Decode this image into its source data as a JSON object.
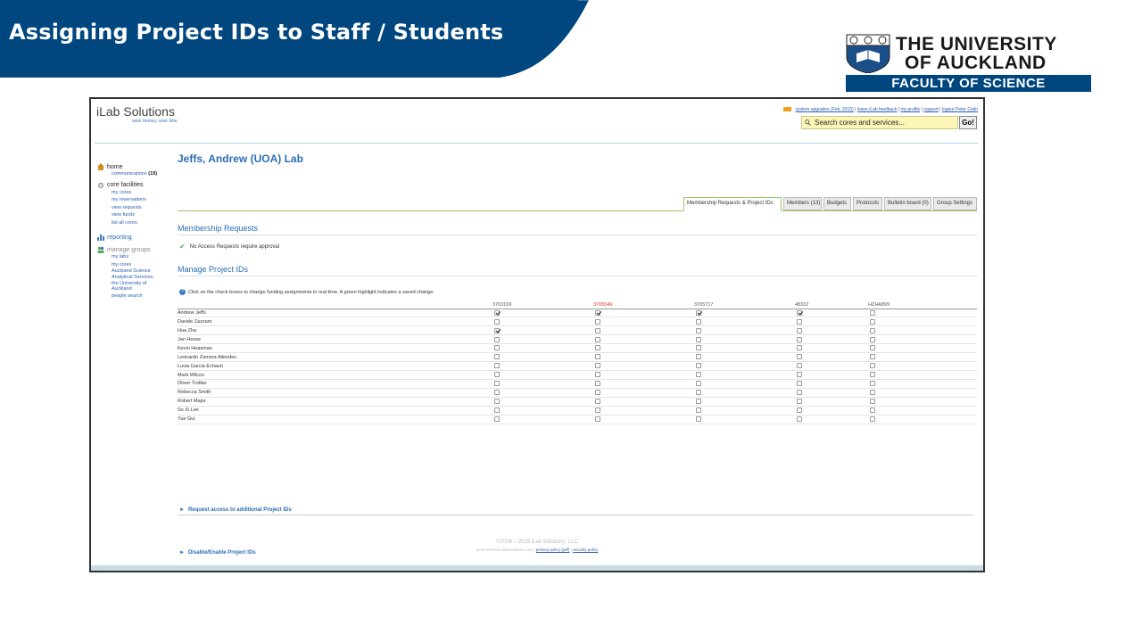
{
  "slide": {
    "title": "Assigning Project IDs to Staff / Students",
    "logo": {
      "line1": "THE UNIVERSITY",
      "line2": "OF AUCKLAND",
      "faculty": "FACULTY OF SCIENCE"
    }
  },
  "colors": {
    "banner": "#00467f",
    "link": "#2c6db5",
    "tab_border": "#9cc56c",
    "red_project": "#d83030"
  },
  "ilab": {
    "logo": "iLab Solutions",
    "tagline": "save money, save time",
    "top_links": [
      "system upgrades (Feb, 2015)",
      "leave iLab feedback",
      "my profile",
      "support",
      "logout Peter Cetin"
    ],
    "search_placeholder": "Search cores and services...",
    "go_label": "Go!"
  },
  "sidebar": {
    "home": "home",
    "communications": "communications",
    "communications_count": "(19)",
    "core_facilities": "core facilities",
    "core_items": [
      "my cores",
      "my reservations",
      "view requests",
      "view funds",
      "list all cores"
    ],
    "reporting": "reporting",
    "manage_groups": "manage groups",
    "group_items": [
      "my labs",
      "my cores",
      "Auckland Science",
      "Analytical Services,",
      "the University of",
      "Auckland",
      "people search"
    ]
  },
  "main": {
    "lab_title": "Jeffs, Andrew (UOA) Lab",
    "tabs": [
      "Membership Requests & Project IDs",
      "Members (13)",
      "Budgets",
      "Protocols",
      "Bulletin board (0)",
      "Group Settings"
    ],
    "membership_heading": "Membership Requests",
    "membership_note": "No Access Requests require approval",
    "manage_heading": "Manage Project IDs",
    "manage_note": "Click on the check boxes to change funding assignments in real time. A green highlight indicates a saved change.",
    "project_ids": [
      "3703199",
      "3705549",
      "3705717",
      "48332",
      "HZHA899"
    ],
    "members": [
      {
        "name": "Andrew Jeffs",
        "checks": [
          true,
          true,
          true,
          true,
          false
        ]
      },
      {
        "name": "Davide Zazzaro",
        "checks": [
          false,
          false,
          false,
          false,
          false
        ]
      },
      {
        "name": "Hua Zha",
        "checks": [
          true,
          false,
          false,
          false,
          false
        ]
      },
      {
        "name": "Jan Hesse",
        "checks": [
          false,
          false,
          false,
          false,
          false
        ]
      },
      {
        "name": "Kevin Heasman",
        "checks": [
          false,
          false,
          false,
          false,
          false
        ]
      },
      {
        "name": "Leonardo Zamora Allendes",
        "checks": [
          false,
          false,
          false,
          false,
          false
        ]
      },
      {
        "name": "Luvia Garcia Echauri",
        "checks": [
          false,
          false,
          false,
          false,
          false
        ]
      },
      {
        "name": "Mark Wilcox",
        "checks": [
          false,
          false,
          false,
          false,
          false
        ]
      },
      {
        "name": "Oliver Trottier",
        "checks": [
          false,
          false,
          false,
          false,
          false
        ]
      },
      {
        "name": "Rebecca Smith",
        "checks": [
          false,
          false,
          false,
          false,
          false
        ]
      },
      {
        "name": "Robert Major",
        "checks": [
          false,
          false,
          false,
          false,
          false
        ]
      },
      {
        "name": "So Xi Lee",
        "checks": [
          false,
          false,
          false,
          false,
          false
        ]
      },
      {
        "name": "Yue Gui",
        "checks": [
          false,
          false,
          false,
          false,
          false
        ]
      }
    ],
    "request_access": "Request access to additional Project IDs",
    "disable_enable": "Disable/Enable Project IDs"
  },
  "footer": {
    "copyright": "©2006 – 2015 iLab Solutions, LLC",
    "url": "aeas-services.ilabsolutions.com",
    "privacy": "privacy policy (pdf)",
    "security": "security policy"
  }
}
